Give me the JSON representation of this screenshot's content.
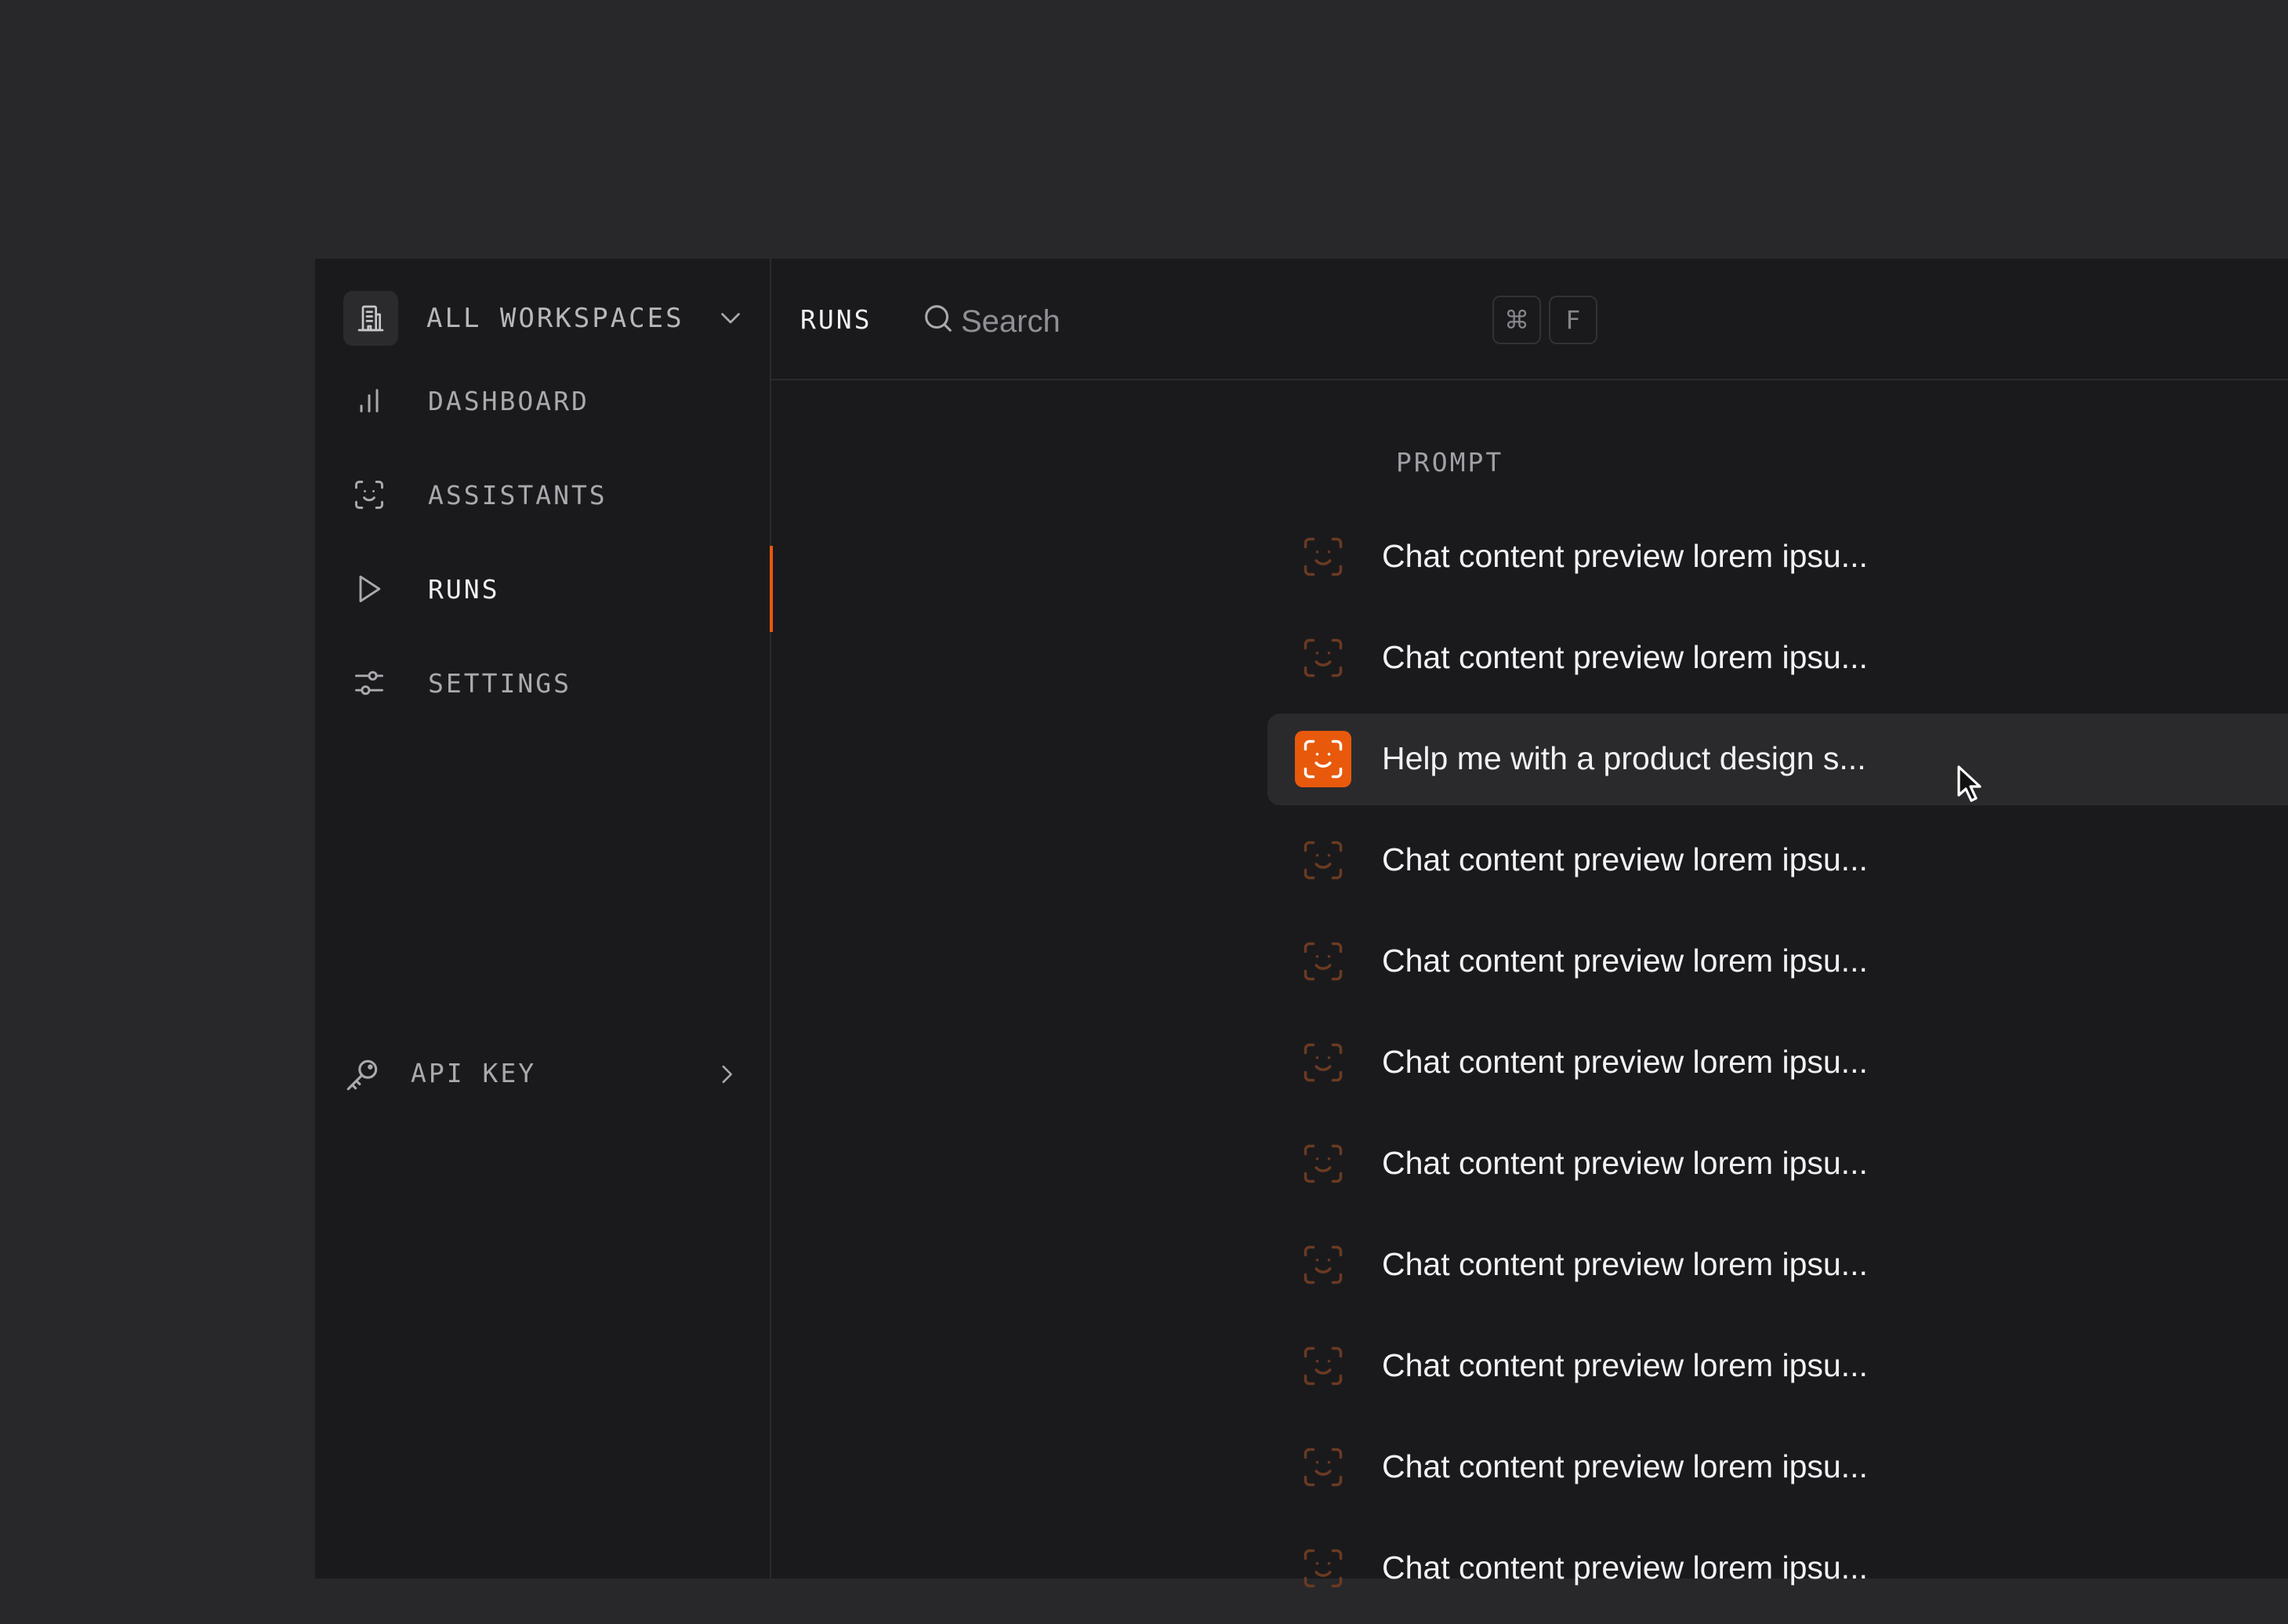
{
  "sidebar": {
    "workspace_label": "ALL WORKSPACES",
    "items": [
      {
        "label": "DASHBOARD",
        "icon": "bar-chart-icon"
      },
      {
        "label": "ASSISTANTS",
        "icon": "face-scan-icon"
      },
      {
        "label": "RUNS",
        "icon": "play-icon",
        "active": true
      },
      {
        "label": "SETTINGS",
        "icon": "sliders-icon"
      }
    ],
    "api_key_label": "API KEY"
  },
  "header": {
    "breadcrumb": "RUNS",
    "search_placeholder": "Search",
    "shortcut_keys": [
      "⌘",
      "F"
    ]
  },
  "table": {
    "column_header": "PROMPT",
    "rows": [
      "Chat content preview lorem ipsu...",
      "Chat content preview lorem ipsu...",
      "Help me with a product design s...",
      "Chat content preview lorem ipsu...",
      "Chat content preview lorem ipsu...",
      "Chat content preview lorem ipsu...",
      "Chat content preview lorem ipsu...",
      "Chat content preview lorem ipsu...",
      "Chat content preview lorem ipsu...",
      "Chat content preview lorem ipsu...",
      "Chat content preview lorem ipsu..."
    ],
    "hovered_row_index": 2
  },
  "colors": {
    "accent": "#e8590c",
    "background": "#1a1a1c",
    "page": "#28282b"
  }
}
